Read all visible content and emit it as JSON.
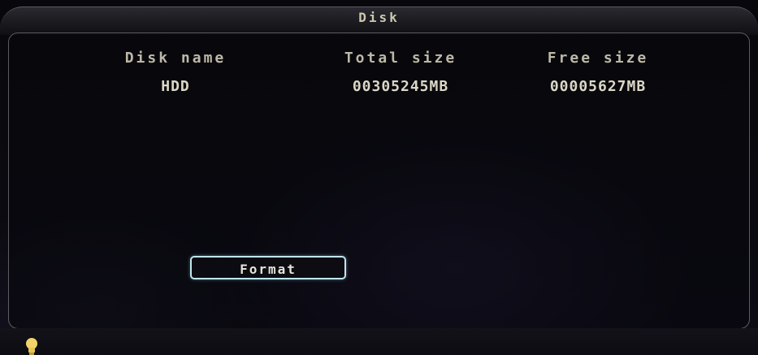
{
  "window": {
    "title": "Disk"
  },
  "table": {
    "headers": [
      "Disk name",
      "Total size",
      "Free size"
    ],
    "rows": [
      [
        "HDD",
        "00305245MB",
        "00005627MB"
      ]
    ]
  },
  "actions": {
    "format_label": "Format"
  },
  "status": {
    "icon": "lightbulb-icon",
    "icon_color": "#f2d36a"
  }
}
